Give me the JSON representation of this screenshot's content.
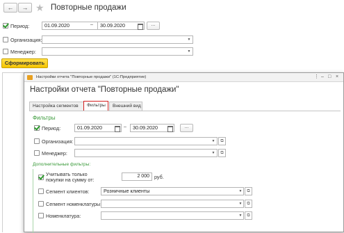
{
  "main": {
    "title": "Повторные продажи",
    "nav_back": "←",
    "nav_forward": "→",
    "star": "★",
    "period_label": "Период:",
    "period_from": "01.09.2020",
    "period_dash": "–",
    "period_to": "30.09.2020",
    "ellipsis": "...",
    "org_label": "Организация:",
    "org_value": "",
    "manager_label": "Менеджер:",
    "manager_value": "",
    "generate_label": "Сформировать"
  },
  "dialog": {
    "window_title": "Настройки отчета \"Повторные продажи\" (1С:Предприятие)",
    "heading": "Настройки отчета \"Повторные продажи\"",
    "win_more": "⋮",
    "win_minimize": "–",
    "win_maximize": "□",
    "win_close": "×",
    "tabs": [
      {
        "label": "Настройка сегментов"
      },
      {
        "label": "Фильтры"
      },
      {
        "label": "Внешний вид"
      }
    ],
    "filters_title": "Фильтры",
    "period_label": "Период:",
    "period_from": "01.09.2020",
    "period_dash": "–",
    "period_to": "30.09.2020",
    "ellipsis": "...",
    "org_label": "Организация:",
    "manager_label": "Менеджер:",
    "additional_title": "Дополнительные фильтры:",
    "only_buyers_label_1": "Учитывать только",
    "only_buyers_label_2": "покупки на сумму от:",
    "amount": "2 000",
    "currency": "руб.",
    "segment_clients_label": "Сегмент клиентов:",
    "segment_clients_value": "Розничные клиенты",
    "segment_items_label": "Сегмент номенклатуры:",
    "items_label": "Номенклатура:"
  },
  "colors": {
    "accent_green": "#3a9a3a",
    "generate_yellow": "#f5c400",
    "active_tab_border": "#d32020"
  },
  "icons": {
    "calendar": "calendar-icon",
    "dropdown": "chevron-down-icon",
    "copy": "copy-icon",
    "check": "checkmark-icon"
  }
}
